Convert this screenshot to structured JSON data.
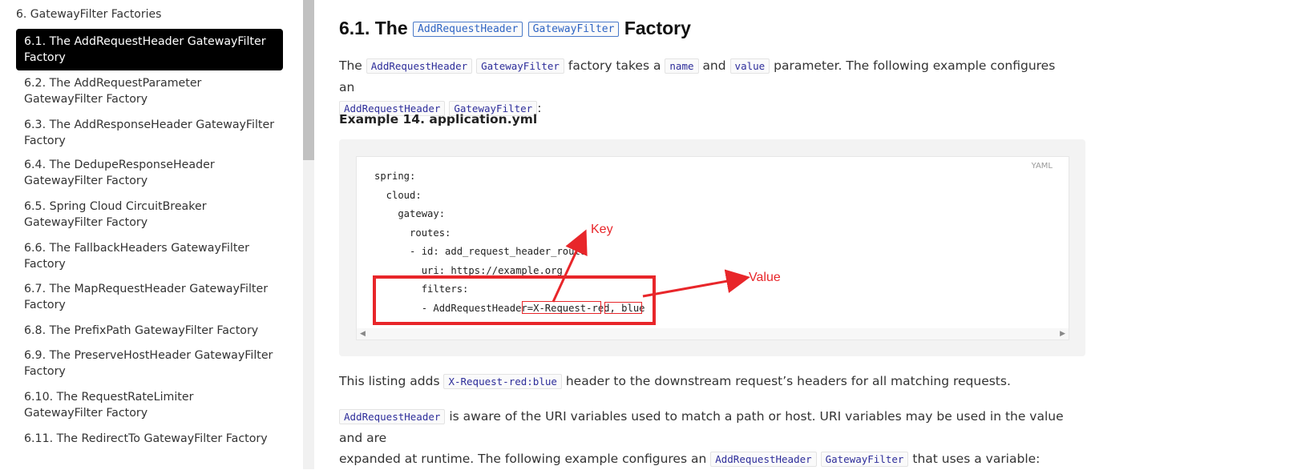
{
  "sidebar": {
    "heading": "6. GatewayFilter Factories",
    "items": [
      {
        "label": "6.1. The AddRequestHeader GatewayFilter Factory",
        "active": true
      },
      {
        "label": "6.2. The AddRequestParameter GatewayFilter Factory"
      },
      {
        "label": "6.3. The AddResponseHeader GatewayFilter Factory"
      },
      {
        "label": "6.4. The DedupeResponseHeader GatewayFilter Factory"
      },
      {
        "label": "6.5. Spring Cloud CircuitBreaker GatewayFilter Factory"
      },
      {
        "label": "6.6. The FallbackHeaders GatewayFilter Factory"
      },
      {
        "label": "6.7. The MapRequestHeader GatewayFilter Factory"
      },
      {
        "label": "6.8. The PrefixPath GatewayFilter Factory"
      },
      {
        "label": "6.9. The PreserveHostHeader GatewayFilter Factory"
      },
      {
        "label": "6.10. The RequestRateLimiter GatewayFilter Factory"
      },
      {
        "label": "6.11. The RedirectTo GatewayFilter Factory"
      }
    ]
  },
  "main": {
    "title": {
      "prefix": "6.1. The",
      "code1": "AddRequestHeader",
      "code2": "GatewayFilter",
      "suffix": "Factory"
    },
    "intro": {
      "t1": "The",
      "c1": "AddRequestHeader",
      "c2": "GatewayFilter",
      "t2": "factory takes a",
      "c3": "name",
      "t3": "and",
      "c4": "value",
      "t4": "parameter. The following example configures an",
      "c5": "AddRequestHeader",
      "c6": "GatewayFilter",
      "t5": ":"
    },
    "example_title": "Example 14. application.yml",
    "code": {
      "language": "YAML",
      "lines": [
        "spring:",
        "  cloud:",
        "    gateway:",
        "      routes:",
        "      - id: add_request_header_route",
        "        uri: https://example.org",
        "        filters:",
        "        - AddRequestHeader=X-Request-red, blue"
      ]
    },
    "annotations": {
      "key": "Key",
      "value": "Value"
    },
    "listing": {
      "t1": "This listing adds",
      "c1": "X-Request-red:blue",
      "t2": "header to the downstream request’s headers for all matching requests."
    },
    "aware": {
      "c1": "AddRequestHeader",
      "t1": "is aware of the URI variables used to match a path or host. URI variables may be used in the value and are",
      "t2": "expanded at runtime. The following example configures an",
      "c2": "AddRequestHeader",
      "c3": "GatewayFilter",
      "t3": "that uses a variable:"
    }
  }
}
